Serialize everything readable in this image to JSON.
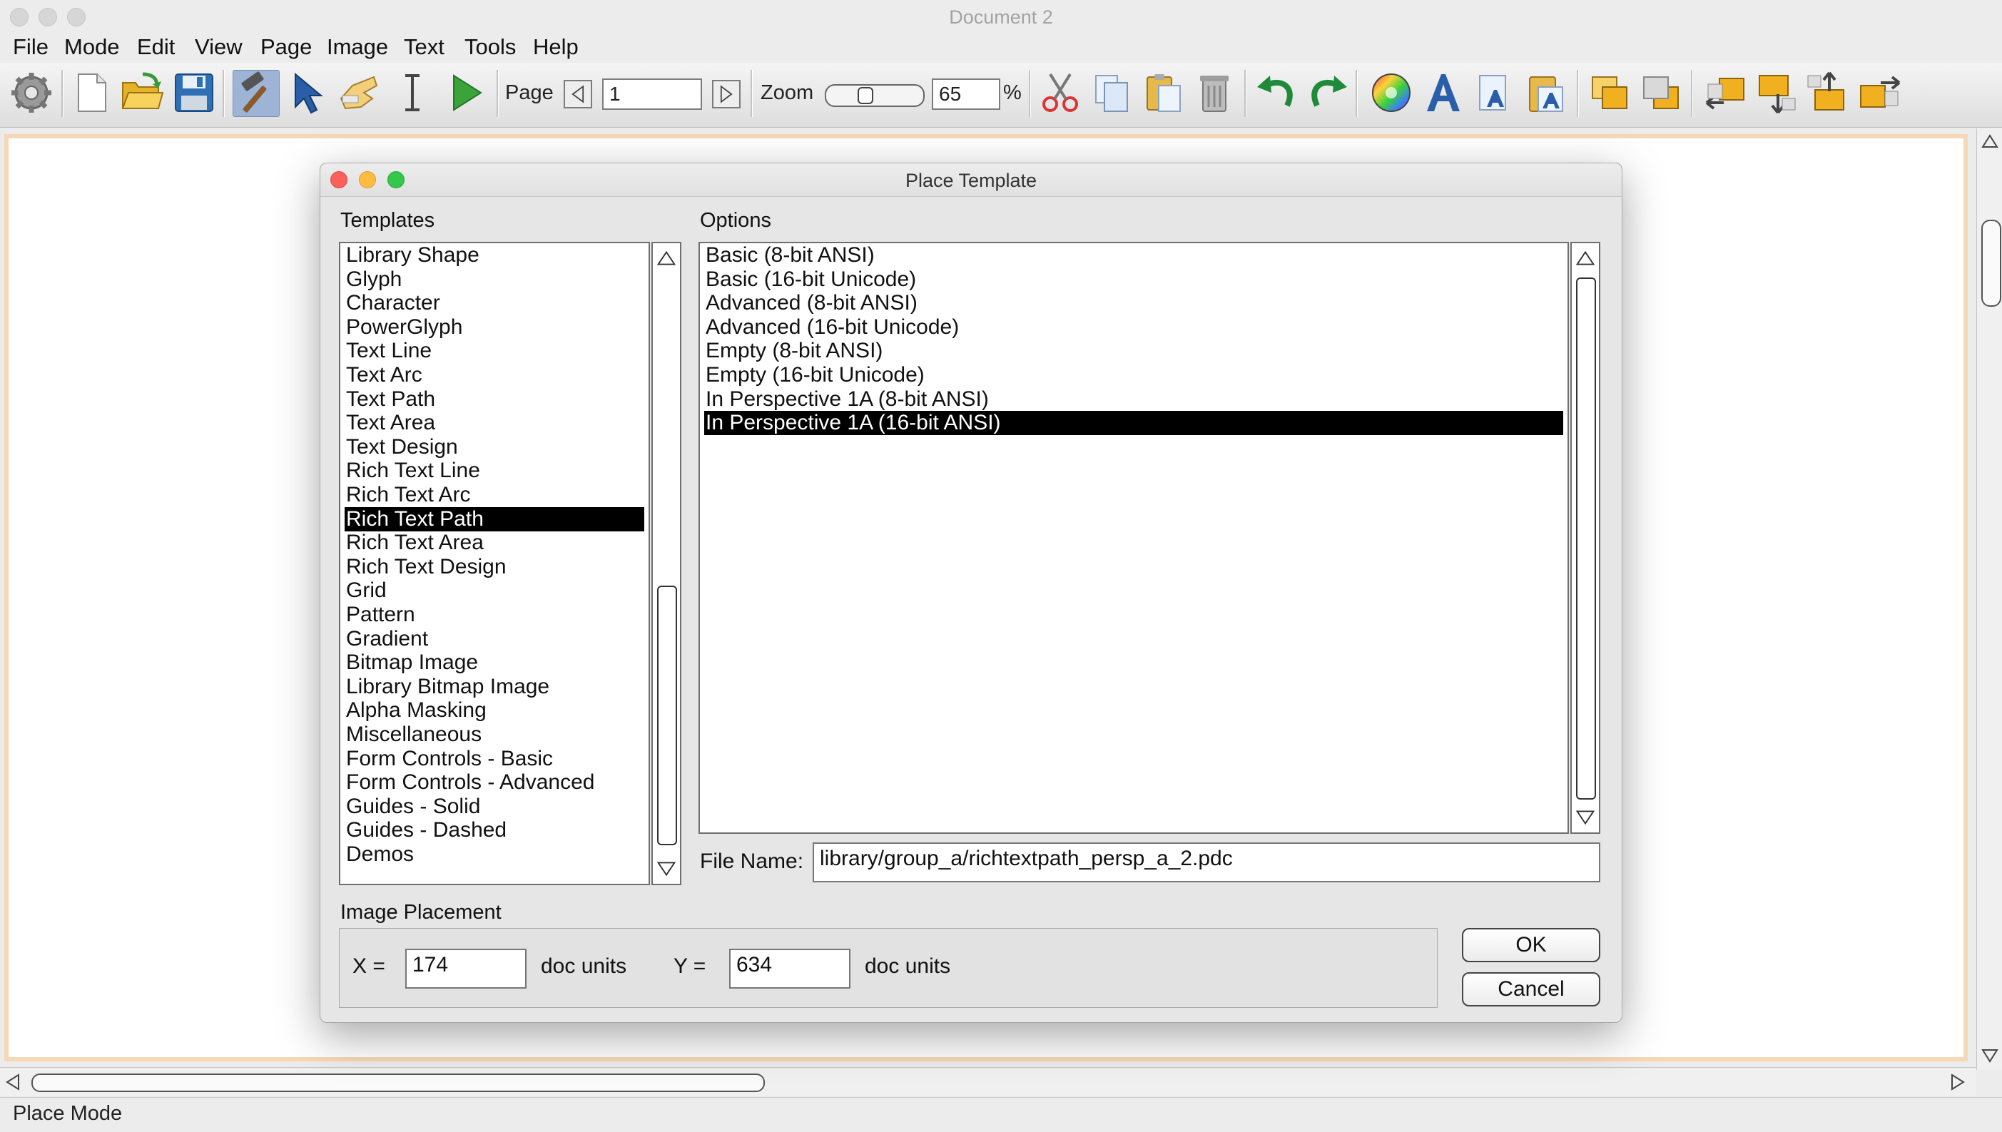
{
  "window": {
    "title": "Document 2"
  },
  "menubar": {
    "items": [
      "File",
      "Mode",
      "Edit",
      "View",
      "Page",
      "Image",
      "Text",
      "Tools",
      "Help"
    ]
  },
  "toolbar": {
    "page_label": "Page",
    "page_value": "1",
    "zoom_label": "Zoom",
    "zoom_value": "65",
    "zoom_unit": "%",
    "icons": [
      "settings-gear",
      "new-document",
      "open-folder",
      "save-disk",
      "place-mode-hammer",
      "select-arrow",
      "hand-pan",
      "text-cursor",
      "run-play",
      "cut-scissors",
      "copy",
      "paste",
      "delete-trash",
      "undo",
      "redo",
      "color-wheel",
      "text-style",
      "text-frame",
      "text-clipboard",
      "bring-front",
      "send-back",
      "align-left",
      "align-bottom",
      "align-top",
      "align-right"
    ]
  },
  "dialog": {
    "title": "Place Template",
    "templates_label": "Templates",
    "templates": [
      "Library Shape",
      "Glyph",
      "Character",
      "PowerGlyph",
      "Text Line",
      "Text Arc",
      "Text Path",
      "Text Area",
      "Text Design",
      "Rich Text Line",
      "Rich Text Arc",
      "Rich Text Path",
      "Rich Text Area",
      "Rich Text Design",
      "Grid",
      "Pattern",
      "Gradient",
      "Bitmap Image",
      "Library Bitmap Image",
      "Alpha Masking",
      "Miscellaneous",
      "Form Controls - Basic",
      "Form Controls - Advanced",
      "Guides - Solid",
      "Guides - Dashed",
      "Demos"
    ],
    "templates_selected": "Rich Text Path",
    "options_label": "Options",
    "options": [
      "Basic (8-bit ANSI)",
      "Basic (16-bit Unicode)",
      "Advanced (8-bit ANSI)",
      "Advanced (16-bit Unicode)",
      "Empty (8-bit ANSI)",
      "Empty (16-bit Unicode)",
      "In Perspective 1A (8-bit ANSI)",
      "In Perspective 1A (16-bit ANSI)"
    ],
    "options_selected": "In Perspective 1A (16-bit ANSI)",
    "file_name_label": "File Name:",
    "file_name_value": "library/group_a/richtextpath_persp_a_2.pdc",
    "placement_label": "Image Placement",
    "x_label": "X =",
    "x_value": "174",
    "x_units": "doc units",
    "y_label": "Y =",
    "y_value": "634",
    "y_units": "doc units",
    "ok_label": "OK",
    "cancel_label": "Cancel"
  },
  "statusbar": {
    "text": "Place Mode"
  },
  "colors": {
    "selection": "#000000",
    "page_border": "#f6d7b6",
    "active_tool": "#9db4d6",
    "close_red": "#fc605c",
    "minimize_yellow": "#fdbc40",
    "zoom_green": "#34c84a"
  }
}
